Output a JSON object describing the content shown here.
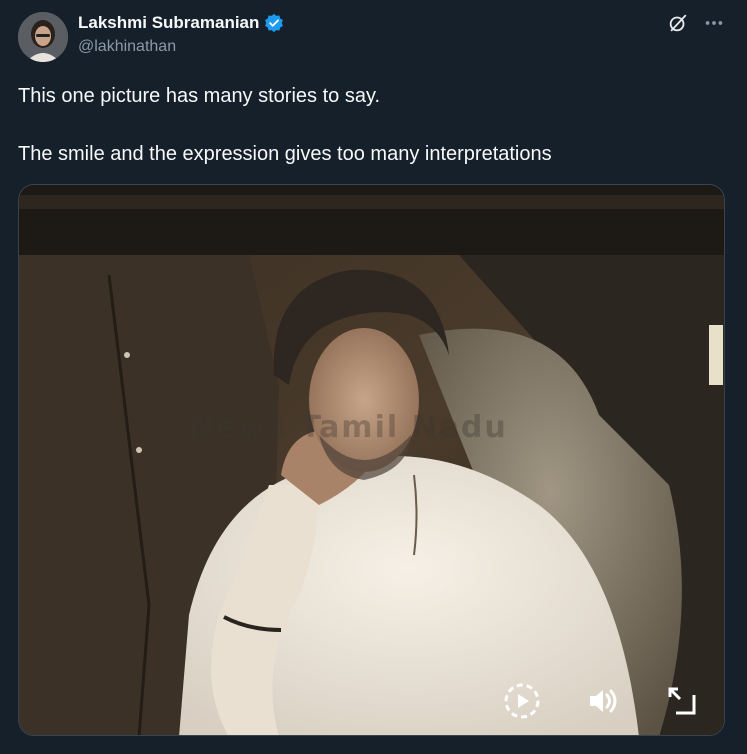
{
  "author": {
    "display_name": "Lakshmi Subramanian",
    "handle": "@lakhinathan",
    "verified_icon": "verified-badge-icon",
    "avatar": "avatar"
  },
  "header_actions": {
    "grok_icon": "grok-icon",
    "more_icon": "more-icon"
  },
  "tweet": {
    "line1": "This one picture has many stories to say.",
    "line2": "The smile and the expression gives too many interpretations"
  },
  "media": {
    "watermark": "News Tamil Nadu",
    "controls": {
      "play_icon": "play-icon",
      "volume_icon": "volume-icon",
      "fullscreen_icon": "fullscreen-icon"
    }
  },
  "colors": {
    "background": "#15202b",
    "primary_text": "#f7f9f9",
    "secondary_text": "#8b98a5",
    "verified_blue": "#1d9bf0",
    "border": "#38444d"
  }
}
